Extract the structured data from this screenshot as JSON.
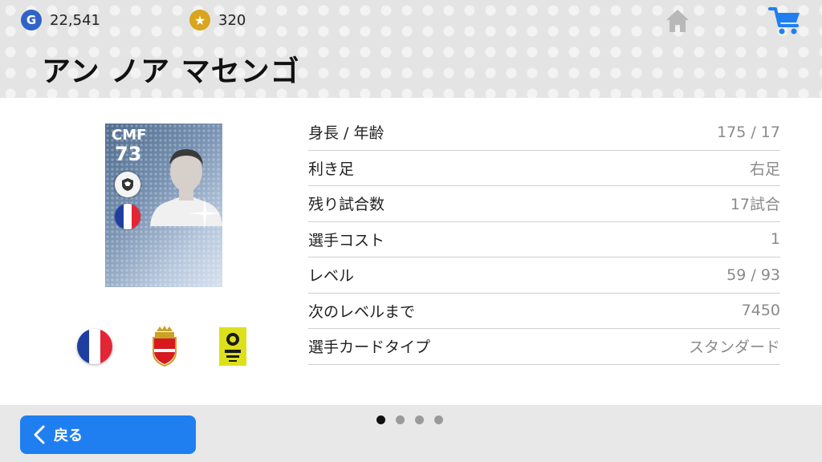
{
  "header": {
    "gp_icon": "G",
    "gp_value": "22,541",
    "coin_icon": "★",
    "coin_value": "320",
    "player_name": "アン ノア マセンゴ"
  },
  "card": {
    "position": "CMF",
    "rating": "73"
  },
  "info": [
    {
      "label": "身長 / 年齢",
      "value": "175 / 17"
    },
    {
      "label": "利き足",
      "value": "右足"
    },
    {
      "label": "残り試合数",
      "value": "17試合"
    },
    {
      "label": "選手コスト",
      "value": "1"
    },
    {
      "label": "レベル",
      "value": "59 / 93"
    },
    {
      "label": "次のレベルまで",
      "value": "7450"
    },
    {
      "label": "選手カードタイプ",
      "value": "スタンダード"
    }
  ],
  "footer": {
    "back_label": "戻る",
    "page_count": 4,
    "active_page": 1
  },
  "colors": {
    "accent_blue": "#1f7ff0",
    "gp_blue": "#2f63c9",
    "coin_gold": "#d8a51c"
  },
  "icons": [
    "gp-icon",
    "coin-icon",
    "home-icon",
    "cart-icon",
    "france-flag-icon",
    "monaco-crest-icon",
    "ligue1-logo-icon",
    "chevron-left-icon"
  ]
}
